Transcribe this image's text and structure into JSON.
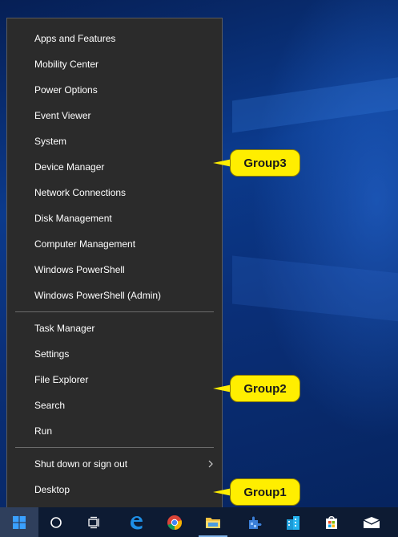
{
  "desktop": {
    "top_strip_text": "· · · · · · · · · · · · · · · · · · · ·"
  },
  "menu": {
    "group3": [
      {
        "label": "Apps and Features"
      },
      {
        "label": "Mobility Center"
      },
      {
        "label": "Power Options"
      },
      {
        "label": "Event Viewer"
      },
      {
        "label": "System"
      },
      {
        "label": "Device Manager"
      },
      {
        "label": "Network Connections"
      },
      {
        "label": "Disk Management"
      },
      {
        "label": "Computer Management"
      },
      {
        "label": "Windows PowerShell"
      },
      {
        "label": "Windows PowerShell (Admin)"
      }
    ],
    "group2": [
      {
        "label": "Task Manager"
      },
      {
        "label": "Settings"
      },
      {
        "label": "File Explorer"
      },
      {
        "label": "Search"
      },
      {
        "label": "Run"
      }
    ],
    "group1": [
      {
        "label": "Shut down or sign out",
        "has_submenu": true
      },
      {
        "label": "Desktop"
      }
    ]
  },
  "callouts": {
    "group3": "Group3",
    "group2": "Group2",
    "group1": "Group1",
    "color": "#ffee00"
  },
  "taskbar": {
    "items": [
      "windows-start-icon",
      "cortana-search-icon",
      "task-view-icon",
      "edge-icon",
      "chrome-icon",
      "file-explorer-icon",
      "puzzle-app-icon",
      "building-app-icon",
      "store-icon",
      "mail-icon"
    ],
    "background": "#0d1b33"
  }
}
